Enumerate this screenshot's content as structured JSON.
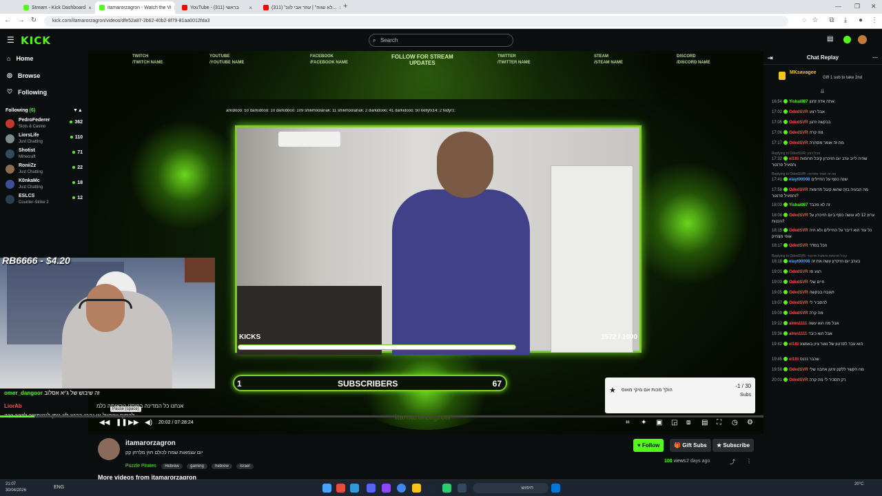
{
  "browser": {
    "tabs": [
      {
        "title": "Stream - Kick Dashboard",
        "color": "#53fc18"
      },
      {
        "title": "itamarorzagron - Watch the Vi",
        "color": "#53fc18"
      },
      {
        "title": "YouTube - (311) בראשי",
        "color": "#ff0000"
      },
      {
        "title": "(311) \"לא שווה\" | עוזר אבי לוונ...",
        "color": "#ff0000"
      }
    ],
    "url": "kick.com/itamarorzagron/videos/dfe52a87-2b62-40b2-8f79-81aa0012fda3"
  },
  "header": {
    "logo": "KICK",
    "search_placeholder": "Search"
  },
  "sidebar": {
    "nav": [
      {
        "label": "Home",
        "icon": "home-icon"
      },
      {
        "label": "Browse",
        "icon": "compass-icon"
      },
      {
        "label": "Following",
        "icon": "heart-icon"
      }
    ],
    "following_label": "Following",
    "following_count": "(6)",
    "channels": [
      {
        "name": "PedroFederer",
        "category": "Slots & Casino",
        "viewers": "362",
        "color": "#c0392b"
      },
      {
        "name": "LiorsLife",
        "category": "Just Chatting",
        "viewers": "110",
        "color": "#7f8c8d"
      },
      {
        "name": "Shotist",
        "category": "Minecraft",
        "viewers": "71",
        "color": "#34495e"
      },
      {
        "name": "RoniiZz",
        "category": "Just Chatting",
        "viewers": "22",
        "color": "#8e6e53"
      },
      {
        "name": "K0nkaMc",
        "category": "Just Chatting",
        "viewers": "18",
        "color": "#3d4f9a"
      },
      {
        "name": "ESLCS",
        "category": "Counter-Strike 2",
        "viewers": "12",
        "color": "#2c3e50"
      }
    ]
  },
  "overlay": {
    "social": [
      {
        "platform": "TWITCH",
        "handle": "/TWITCH NAME"
      },
      {
        "platform": "YOUTUBE",
        "handle": "/YOUTUBE NAME"
      },
      {
        "platform": "FACEBOOK",
        "handle": "/FACEBOOK NAME"
      },
      {
        "platform": "FOLLOW FOR STREAM",
        "handle": "UPDATES"
      },
      {
        "platform": "TWITTER",
        "handle": "/TWITTER NAME"
      },
      {
        "platform": "STEAM",
        "handle": "/STEAM NAME"
      },
      {
        "platform": "DISCORD",
        "handle": "/DISCORD NAME"
      }
    ],
    "ticker": "arkidooo: 53   darkidooo: 10   darkidooo: 109   shilehoolanak: 11   shilehoolanak: 2   darkidooo: 41   darkidooo: 50   kellytx14: 2   tedyr1:",
    "kicks_label": "KICKS",
    "kicks_progress": "1572 / 1000",
    "subs_left": "1",
    "subs_label": "SUBSCRIBERS",
    "subs_right": "67",
    "channel_watermark": "itamarorzagron",
    "donation": "RB6666 - $4.20",
    "overlay_chat": [
      {
        "user": "omer_dangoor",
        "text": "זה שיבוש של ג'יא אסלוב"
      },
      {
        "user": "",
        "text": "אנחנו כל המדינה בפוסט טראומה כלמ"
      },
      {
        "user": "LiorAb",
        "text": "לבסוף שנכשל או נהרג בבגא לא נותן לגטימציה לדבר ככה"
      }
    ],
    "subs_widget_text": "הולך מכות אם מיקי מאוס",
    "subs_widget_count": "-1 / 30",
    "subs_widget_label": "Subs"
  },
  "player": {
    "time": "20:02 / 07:28:24",
    "tooltip": "Pause (space)",
    "progress": 0.045
  },
  "chat": {
    "title": "Chat Replay",
    "pinned_user": "MKsavagee",
    "pinned_text": "Gift 1 sub to take 2nd",
    "messages": [
      {
        "time": "16:54",
        "user": "Yishai987",
        "color": "#53fc18",
        "text": "אתה אדה זרגון",
        "reply": ""
      },
      {
        "time": "17:02",
        "user": "OdedSVR",
        "color": "#ff4d4d",
        "text": "אבל רצע",
        "reply": ""
      },
      {
        "time": "17:05",
        "user": "OdedSVR",
        "color": "#ff4d4d",
        "text": "בבקשה זרגון",
        "reply": ""
      },
      {
        "time": "17:06",
        "user": "OdedSVR",
        "color": "#ff4d4d",
        "text": "מה קרה",
        "reply": ""
      },
      {
        "time": "17:17",
        "user": "OdedSVR",
        "color": "#ff4d4d",
        "text": "מה זה אומר מסחרה",
        "reply": ""
      },
      {
        "time": "17:32",
        "user": "el1tti",
        "color": "#ff4d4d",
        "text": "שהיה לייב ערב יום הזיכרון קיבל תרומות והפעיל פרנטר",
        "reply": "Replying to OdedSVR: אבל רצע"
      },
      {
        "time": "17:41",
        "user": "elayt00008",
        "color": "#4da6ff",
        "text": "שנה כסף על החיילים",
        "reply": "Replying to OdedSVR: מה זה אומר מסחרה"
      },
      {
        "time": "17:58",
        "user": "OdedSVR",
        "color": "#ff4d4d",
        "text": "מה הבעיה בזה שהוא קיבל תרומות והפעיל פרנטר?",
        "reply": ""
      },
      {
        "time": "18:03",
        "user": "Yishai987",
        "color": "#53fc18",
        "text": "זה לא מכבד",
        "reply": ""
      },
      {
        "time": "18:08",
        "user": "OdedSVR",
        "color": "#ff4d4d",
        "text": "ערוץ 12 לא עושה כסף ביום הזיכרון על הכנות?",
        "reply": ""
      },
      {
        "time": "18:15",
        "user": "OdedSVR",
        "color": "#ff4d4d",
        "text": "כל עוד הוא דיבר על החיילים ולא היה אופי מצחיק",
        "reply": ""
      },
      {
        "time": "18:17",
        "user": "OdedSVR",
        "color": "#ff4d4d",
        "text": "הכל בסדר",
        "reply": ""
      },
      {
        "time": "18:18",
        "user": "elayt00008",
        "color": "#4da6ff",
        "text": "בערב יום הזיכרון עשה את זה",
        "reply": "Replying to OdedSVR: קיבל תרומות והפעיל פרנטר"
      },
      {
        "time": "19:01",
        "user": "OdedSVR",
        "color": "#ff4d4d",
        "text": "רצע פז",
        "reply": ""
      },
      {
        "time": "19:03",
        "user": "OdedSVR",
        "color": "#ff4d4d",
        "text": "חיים שלי",
        "reply": ""
      },
      {
        "time": "19:05",
        "user": "OdedSVR",
        "color": "#ff4d4d",
        "text": "תגובה בבקשה",
        "reply": ""
      },
      {
        "time": "19:07",
        "user": "OdedSVR",
        "color": "#ff4d4d",
        "text": "להסביר לי",
        "reply": ""
      },
      {
        "time": "19:09",
        "user": "OdedSVR",
        "color": "#ff4d4d",
        "text": "מה קרה",
        "reply": ""
      },
      {
        "time": "19:12",
        "user": "almn1111",
        "color": "#ff4d4d",
        "text": "אבל מה הוא עשה",
        "reply": ""
      },
      {
        "time": "19:36",
        "user": "almn1111",
        "color": "#ff4d4d",
        "text": "אבל הוא כיבד",
        "reply": ""
      },
      {
        "time": "19:42",
        "user": "el1tti",
        "color": "#ff4d4d",
        "text": "הוא עבר לסרטון של נאור ציון באמצע",
        "reply": ""
      },
      {
        "time": "19:45",
        "user": "el1tti",
        "color": "#ff4d4d",
        "text": "שכבר נכנס",
        "reply": ""
      },
      {
        "time": "19:58",
        "user": "OdedSVR",
        "color": "#ff4d4d",
        "text": "מה הקשר ללקק זרגון אהבה שלי",
        "reply": ""
      },
      {
        "time": "20:01",
        "user": "OdedSVR",
        "color": "#ff4d4d",
        "text": "רק תסביר לי מה קרה",
        "reply": ""
      }
    ]
  },
  "video_info": {
    "channel": "itamarorzagron",
    "title": "יום עצמאות שמח לכולם חוץ מלרחן קק",
    "category": "Puzzle Pirates",
    "tags": [
      "Hebrew",
      "gaming",
      "hebrew",
      "israel"
    ],
    "follow_label": "Follow",
    "gift_label": "Gift Subs",
    "subscribe_label": "Subscribe",
    "views": "100",
    "views_label": "views",
    "age": "2 days ago",
    "more_videos": "More videos from itamarorzagron"
  },
  "taskbar": {
    "time": "21:07",
    "date": "30/04/2026",
    "lang": "ENG",
    "weather": "20°C",
    "search_placeholder": "חיפוש"
  },
  "colors": {
    "accent": "#53fc18",
    "background": "#0b0e0f"
  }
}
